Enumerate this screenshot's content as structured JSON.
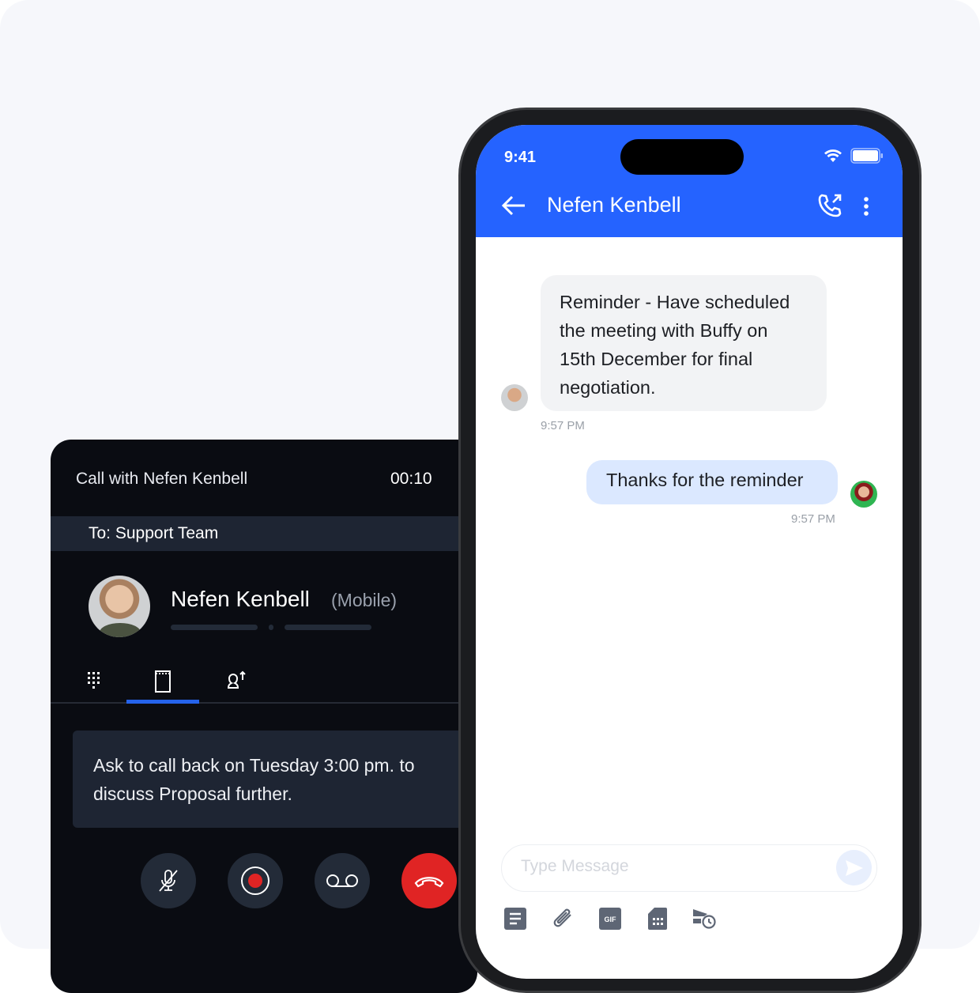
{
  "call_panel": {
    "title": "Call with Nefen Kenbell",
    "timer": "00:10",
    "to": "To: Support Team",
    "contact_name": "Nefen Kenbell",
    "contact_type": "(Mobile)",
    "tabs": [
      {
        "icon": "dialpad-icon"
      },
      {
        "icon": "notes-icon",
        "active": true
      },
      {
        "icon": "transfer-icon"
      }
    ],
    "note": "Ask to call back on Tuesday 3:00 pm. to discuss Proposal further.",
    "controls": [
      {
        "icon": "mute-icon"
      },
      {
        "icon": "record-icon"
      },
      {
        "icon": "voicemail-icon"
      },
      {
        "icon": "hangup-icon",
        "color": "#e02424"
      }
    ]
  },
  "phone": {
    "status_time": "9:41",
    "header": {
      "title": "Nefen Kenbell"
    },
    "messages": [
      {
        "direction": "incoming",
        "text": "Reminder - Have scheduled the meeting with Buffy on 15th December for final negotiation.",
        "time": "9:57 PM"
      },
      {
        "direction": "outgoing",
        "text": "Thanks for the reminder",
        "time": "9:57 PM"
      }
    ],
    "input": {
      "placeholder": "Type Message"
    },
    "toolbar": [
      "template-icon",
      "attachment-icon",
      "gif-icon",
      "sim-icon",
      "schedule-send-icon"
    ],
    "accent": "#2563ff"
  }
}
